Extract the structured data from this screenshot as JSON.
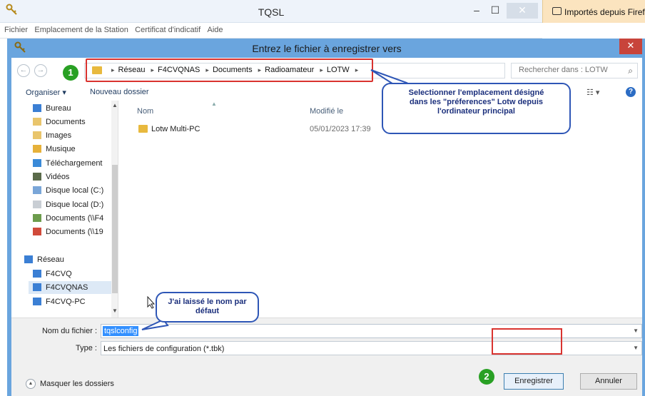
{
  "tqsl_window": {
    "title": "TQSL",
    "minimize": "–",
    "maximize": "☐",
    "close": "✕",
    "menu": [
      "Fichier",
      "Emplacement de la Station",
      "Certificat d'indicatif",
      "Aide"
    ]
  },
  "bookmark": {
    "label": "Importés depuis Firefox"
  },
  "dialog": {
    "title": "Entrez le fichier à enregistrer vers",
    "close": "✕",
    "back": "←",
    "forward": "→",
    "breadcrumbs": [
      "Réseau",
      "F4CVQNAS",
      "Documents",
      "Radioamateur",
      "LOTW"
    ],
    "address_dropdown": "⌄",
    "refresh": "↻",
    "search_placeholder": "Rechercher dans : LOTW",
    "search_icon": "⌕",
    "toolbar": {
      "organize": "Organiser ▾",
      "new_folder": "Nouveau dossier",
      "view": "☷ ▾",
      "help": "?"
    },
    "nav_items": [
      {
        "label": "Bureau",
        "icon": "desktop-icon"
      },
      {
        "label": "Documents",
        "icon": "documents-icon"
      },
      {
        "label": "Images",
        "icon": "images-icon"
      },
      {
        "label": "Musique",
        "icon": "music-icon"
      },
      {
        "label": "Téléchargement",
        "icon": "downloads-icon"
      },
      {
        "label": "Vidéos",
        "icon": "videos-icon"
      },
      {
        "label": "Disque local (C:)",
        "icon": "drive-icon"
      },
      {
        "label": "Disque local (D:)",
        "icon": "drive-icon"
      },
      {
        "label": "Documents (\\\\F4",
        "icon": "network-drive-icon"
      },
      {
        "label": "Documents (\\\\19",
        "icon": "network-drive-error-icon"
      },
      {
        "label": "Réseau",
        "icon": "network-icon"
      },
      {
        "label": "F4CVQ",
        "icon": "computer-icon"
      },
      {
        "label": "F4CVQNAS",
        "icon": "computer-icon"
      },
      {
        "label": "F4CVQ-PC",
        "icon": "computer-icon"
      }
    ],
    "columns": {
      "name": "Nom",
      "modified": "Modifié le"
    },
    "files": [
      {
        "name": "Lotw Multi-PC",
        "modified": "05/01/2023 17:39"
      }
    ],
    "filename_label": "Nom du fichier :",
    "filename_value": "tqslconfig",
    "filetype_label": "Type :",
    "filetype_value": "Les fichiers de configuration (*.tbk)",
    "hide_folders": "Masquer les dossiers",
    "save_button": "Enregistrer",
    "cancel_button": "Annuler"
  },
  "annotations": {
    "badge1": "1",
    "badge2": "2",
    "callout1": [
      "Selectionner l'emplacement désigné",
      "dans les \"préferences\" Lotw depuis",
      "l'ordinateur principal"
    ],
    "callout2": [
      "J'ai laissé le nom par",
      "défaut"
    ]
  },
  "colors": {
    "dialog_frame": "#6aa5de",
    "highlight": "#d9332f",
    "badge": "#29a024",
    "callout_border": "#2e56b6",
    "selection": "#3390ff"
  }
}
